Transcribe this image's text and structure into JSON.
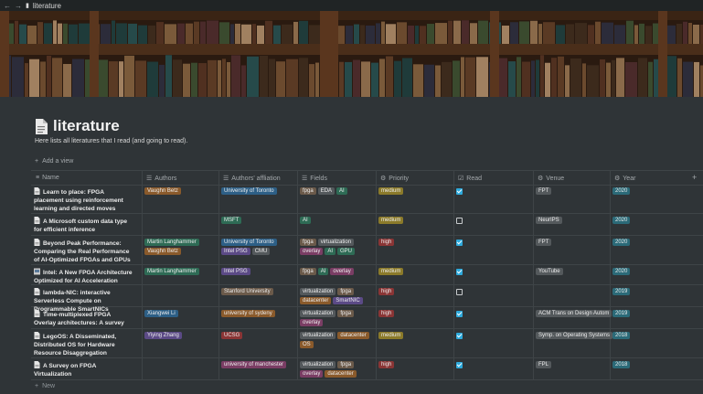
{
  "window": {
    "title": "literature",
    "back": "←",
    "forward": "→"
  },
  "page": {
    "title": "literature",
    "description": "Here lists all literatures that I read (and going to read).",
    "add_view": "Add a view",
    "new_row": "New",
    "add_column": "+"
  },
  "colors": {
    "brown": "#6b5a4a",
    "orange": "#8a5a2b",
    "yellow": "#8b7a2a",
    "green": "#2e6b55",
    "teal": "#2b6a78",
    "blue": "#2d5f86",
    "purple": "#5b4a86",
    "pink": "#7a3d64",
    "red": "#8a3535",
    "gray": "#54595c",
    "checkbox": "#2eaadc"
  },
  "columns": [
    {
      "icon": "text-icon",
      "label": "Name"
    },
    {
      "icon": "list-icon",
      "label": "Authors"
    },
    {
      "icon": "list-icon",
      "label": "Authors' affliation"
    },
    {
      "icon": "list-icon",
      "label": "Fields"
    },
    {
      "icon": "gear-icon",
      "label": "Priority"
    },
    {
      "icon": "checkbox-icon",
      "label": "Read"
    },
    {
      "icon": "gear-icon",
      "label": "Venue"
    },
    {
      "icon": "gear-icon",
      "label": "Year"
    }
  ],
  "rows": [
    {
      "icon": "page-icon",
      "name": "Learn to place: FPGA placement using reinforcement learning and directed moves",
      "authors": [
        {
          "t": "Vaughn Betz",
          "c": "orange"
        }
      ],
      "affiliation": [
        {
          "t": "University of Toronto",
          "c": "blue"
        }
      ],
      "fields": [
        {
          "t": "fpga",
          "c": "brown"
        },
        {
          "t": "EDA",
          "c": "gray"
        },
        {
          "t": "AI",
          "c": "green"
        }
      ],
      "priority": {
        "t": "medium",
        "c": "yellow"
      },
      "read": true,
      "venue": {
        "t": "FPT",
        "c": "gray"
      },
      "year": {
        "t": "2020",
        "c": "teal"
      }
    },
    {
      "icon": "page-icon",
      "name": "A Microsoft custom data type for efficient inference",
      "authors": [],
      "affiliation": [
        {
          "t": "MSFT",
          "c": "green"
        }
      ],
      "fields": [
        {
          "t": "AI",
          "c": "green"
        }
      ],
      "priority": {
        "t": "medium",
        "c": "yellow"
      },
      "read": false,
      "venue": {
        "t": "NeurIPS",
        "c": "gray"
      },
      "year": {
        "t": "2020",
        "c": "teal"
      }
    },
    {
      "icon": "page-icon",
      "name": "Beyond Peak Performance: Comparing the Real Performance of AI-Optimized FPGAs and GPUs",
      "authors": [
        {
          "t": "Martin Langhammer",
          "c": "green"
        },
        {
          "t": "Vaughn Betz",
          "c": "orange"
        }
      ],
      "affiliation": [
        {
          "t": "University of Toronto",
          "c": "blue"
        },
        {
          "t": "Intel PSG",
          "c": "purple"
        },
        {
          "t": "CMU",
          "c": "gray"
        }
      ],
      "fields": [
        {
          "t": "fpga",
          "c": "brown"
        },
        {
          "t": "virtualization",
          "c": "gray"
        },
        {
          "t": "overlay",
          "c": "pink"
        },
        {
          "t": "AI",
          "c": "green"
        },
        {
          "t": "GPU",
          "c": "green"
        }
      ],
      "priority": {
        "t": "high",
        "c": "red"
      },
      "read": true,
      "venue": {
        "t": "FPT",
        "c": "gray"
      },
      "year": {
        "t": "2020",
        "c": "teal"
      }
    },
    {
      "icon": "image-icon",
      "name": "Intel: A New FPGA Architecture Optimized for AI Acceleration",
      "authors": [
        {
          "t": "Martin Langhammer",
          "c": "green"
        }
      ],
      "affiliation": [
        {
          "t": "Intel PSG",
          "c": "purple"
        }
      ],
      "fields": [
        {
          "t": "fpga",
          "c": "brown"
        },
        {
          "t": "AI",
          "c": "green"
        },
        {
          "t": "overlay",
          "c": "pink"
        }
      ],
      "priority": {
        "t": "medium",
        "c": "yellow"
      },
      "read": true,
      "venue": {
        "t": "YouTube",
        "c": "gray"
      },
      "year": {
        "t": "2020",
        "c": "teal"
      }
    },
    {
      "icon": "page-icon",
      "name": "lambda-NIC: interactive Serverless Compute on Programmable SmartNICs",
      "authors": [],
      "affiliation": [
        {
          "t": "Stanford University",
          "c": "brown"
        }
      ],
      "fields": [
        {
          "t": "virtualization",
          "c": "gray"
        },
        {
          "t": "fpga",
          "c": "brown"
        },
        {
          "t": "datacenter",
          "c": "orange"
        },
        {
          "t": "SmartNIC",
          "c": "purple"
        }
      ],
      "priority": {
        "t": "high",
        "c": "red"
      },
      "read": false,
      "venue": null,
      "year": {
        "t": "2019",
        "c": "teal"
      }
    },
    {
      "icon": "page-icon",
      "name": "Time-multiplexed FPGA Overlay architectures: A survey",
      "authors": [
        {
          "t": "Xiangwei Li",
          "c": "blue"
        }
      ],
      "affiliation": [
        {
          "t": "university of sydeny",
          "c": "orange"
        }
      ],
      "fields": [
        {
          "t": "virtualization",
          "c": "gray"
        },
        {
          "t": "fpga",
          "c": "brown"
        },
        {
          "t": "overlay",
          "c": "pink"
        }
      ],
      "priority": {
        "t": "high",
        "c": "red"
      },
      "read": true,
      "venue": {
        "t": "ACM Trans on Design Autom",
        "c": "gray"
      },
      "year": {
        "t": "2019",
        "c": "teal"
      }
    },
    {
      "icon": "page-icon",
      "name": "LegoOS: A Disseminated, Distributed OS for Hardware Resource Disaggregation",
      "authors": [
        {
          "t": "Yiying Zhang",
          "c": "purple"
        }
      ],
      "affiliation": [
        {
          "t": "UCSG",
          "c": "red"
        }
      ],
      "fields": [
        {
          "t": "virtualization",
          "c": "gray"
        },
        {
          "t": "datacenter",
          "c": "orange"
        },
        {
          "t": "OS",
          "c": "orange"
        }
      ],
      "priority": {
        "t": "medium",
        "c": "yellow"
      },
      "read": true,
      "venue": {
        "t": "Symp. on Operating Systems",
        "c": "gray"
      },
      "year": {
        "t": "2018",
        "c": "teal"
      }
    },
    {
      "icon": "page-icon",
      "name": "A Survey on FPGA Virtualization",
      "authors": [],
      "affiliation": [
        {
          "t": "university of manchester",
          "c": "pink"
        }
      ],
      "fields": [
        {
          "t": "virtualization",
          "c": "gray"
        },
        {
          "t": "fpga",
          "c": "brown"
        },
        {
          "t": "overlay",
          "c": "pink"
        },
        {
          "t": "datacenter",
          "c": "orange"
        }
      ],
      "priority": {
        "t": "high",
        "c": "red"
      },
      "read": true,
      "venue": {
        "t": "FPL",
        "c": "gray"
      },
      "year": {
        "t": "2018",
        "c": "teal"
      }
    }
  ]
}
